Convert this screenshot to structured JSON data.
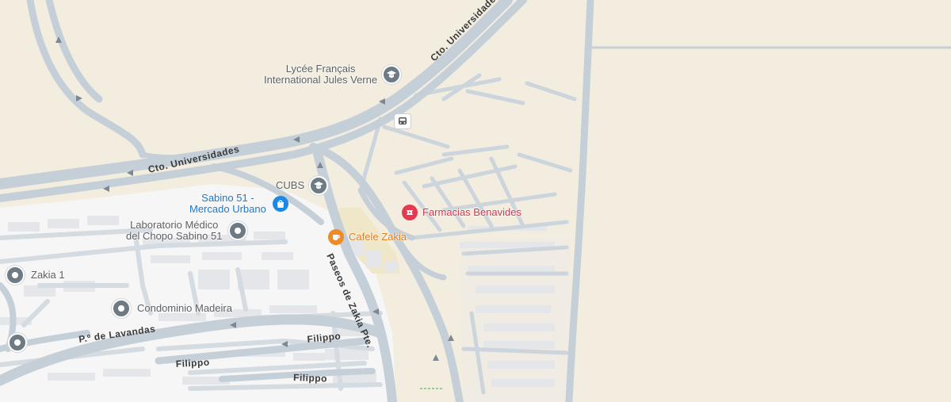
{
  "roads": {
    "cto_universidades_upper": "Cto. Universidades",
    "cto_universidades_lower": "Cto. Universidades",
    "paseos_de_zakia": "Paseos de Zakia Pte.",
    "p_de_lavandas": "P.º de Lavandas",
    "filippo_1": "Filippo",
    "filippo_2": "Filippo",
    "filippo_3": "Filippo"
  },
  "pois": {
    "lycee_line1": "Lycée Français",
    "lycee_line2": "International Jules Verne",
    "cubs": "CUBS",
    "sabino_line1": "Sabino 51 -",
    "sabino_line2": "Mercado Urbano",
    "lab_line1": "Laboratorio Médico",
    "lab_line2": "del Chopo Sabino 51",
    "farmacias": "Farmacias Benavides",
    "cafele": "Cafele Zakia",
    "zakia1": "Zakia 1",
    "madeira": "Condominio Madeira"
  },
  "icons": {
    "school": "school-icon",
    "bus": "bus-stop-icon",
    "shopping": "shopping-bag-icon",
    "pharmacy": "pharmacy-icon",
    "cafe": "coffee-cup-icon",
    "place": "place-pin-icon"
  },
  "colors": {
    "land": "#f3ede0",
    "road": "#c9d3dc",
    "residential": "#f7f7f8",
    "building": "#e2e4e6",
    "pharmacy": "#e53950",
    "shopping": "#1e88e5",
    "cafe": "#f08a24",
    "place": "#6e7a84"
  }
}
